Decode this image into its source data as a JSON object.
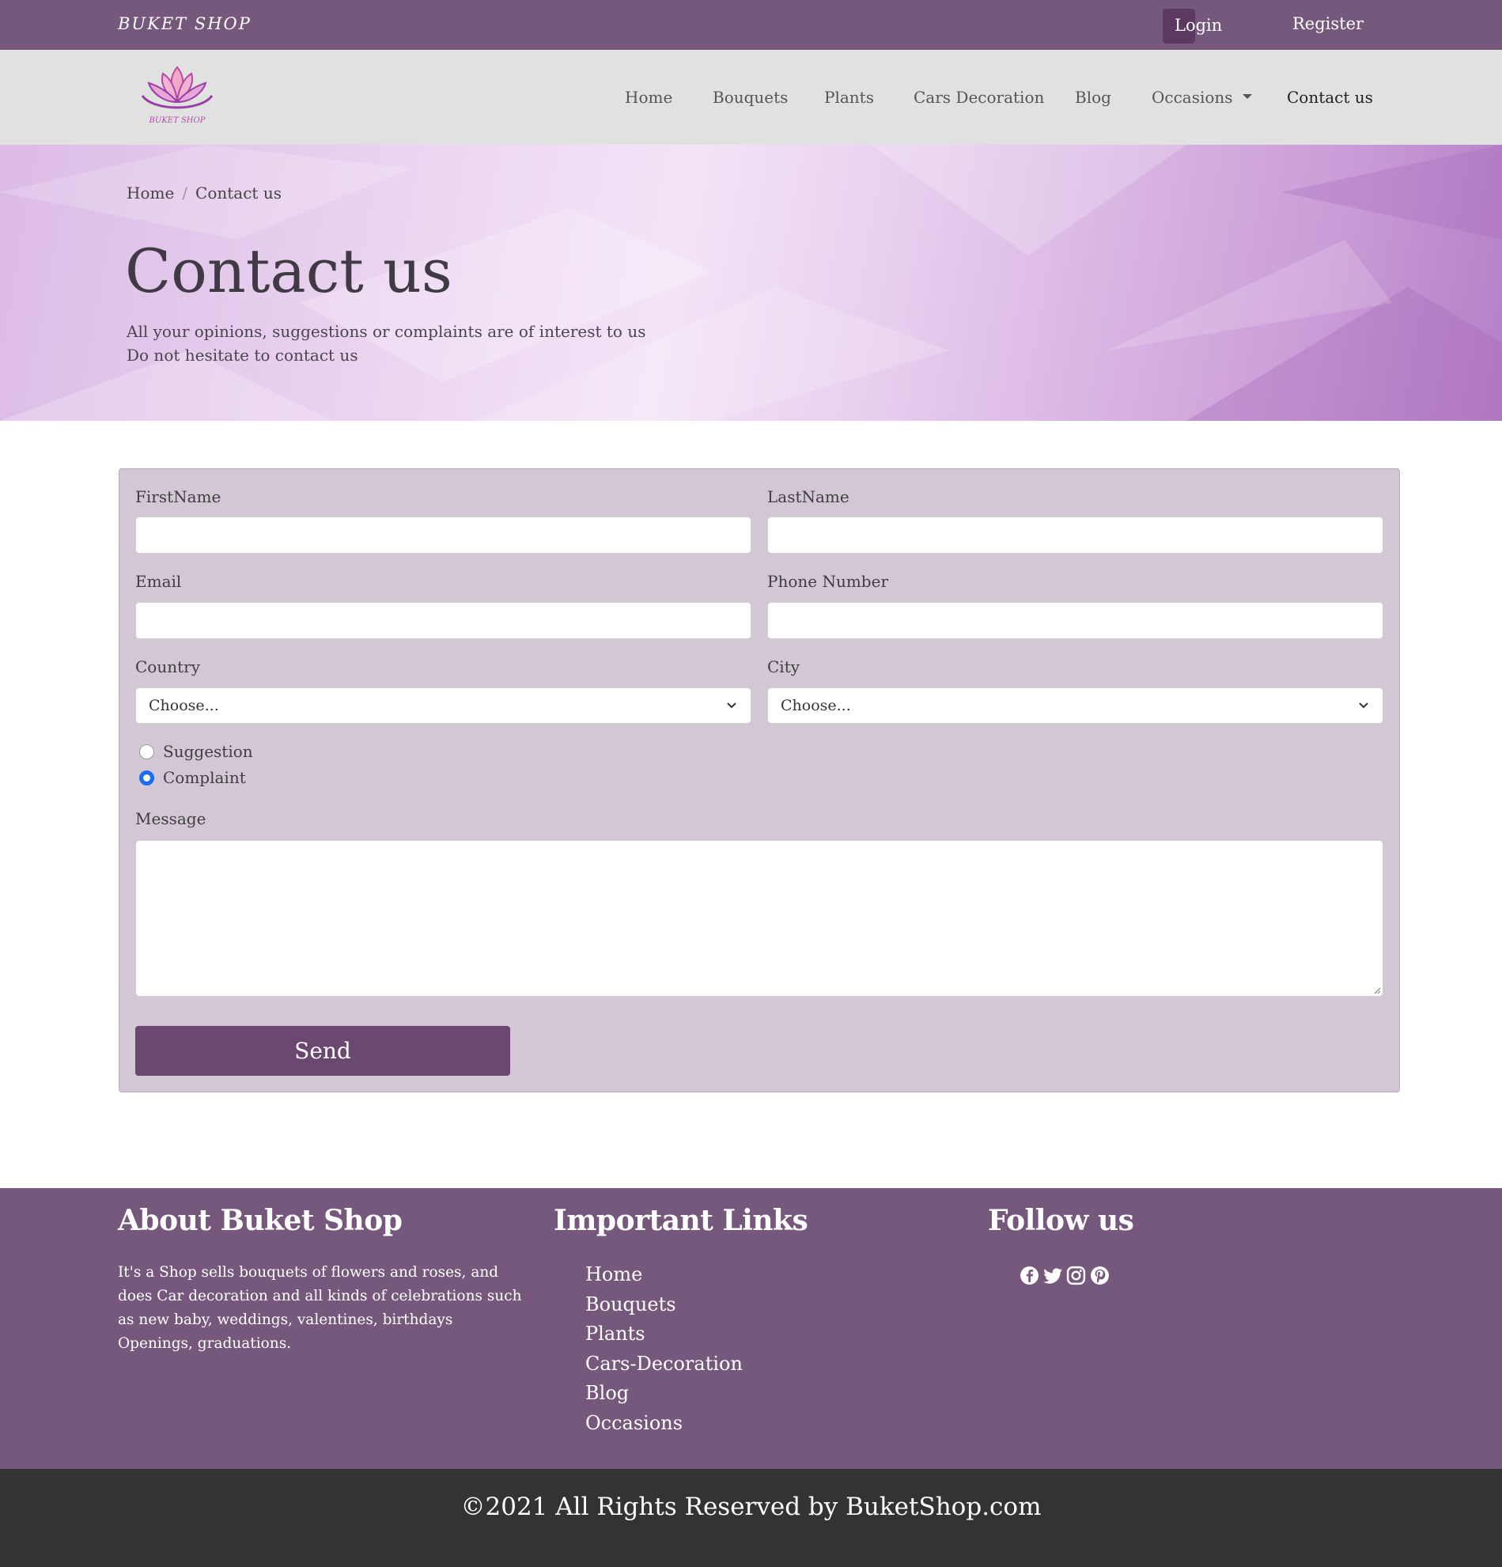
{
  "topbar": {
    "brand": "BUKET SHOP",
    "login": "Login",
    "register": "Register"
  },
  "nav": {
    "items": [
      "Home",
      "Bouquets",
      "Plants",
      "Cars Decoration",
      "Blog",
      "Occasions",
      "Contact us"
    ],
    "active": "Contact us"
  },
  "logo": {
    "caption": "BUKET SHOP"
  },
  "hero": {
    "breadcrumb": [
      "Home",
      "Contact us"
    ],
    "title": "Contact us",
    "subtitle_line1": "All your opinions, suggestions or complaints are of interest to us",
    "subtitle_line2": "Do not hesitate to contact us"
  },
  "form": {
    "firstname_label": "FirstName",
    "firstname_value": "",
    "lastname_label": "LastName",
    "lastname_value": "",
    "email_label": "Email",
    "email_value": "",
    "phone_label": "Phone Number",
    "phone_value": "",
    "country_label": "Country",
    "country_selected": "Choose...",
    "city_label": "City",
    "city_selected": "Choose...",
    "radio_options": [
      "Suggestion",
      "Complaint"
    ],
    "radio_selected": "Complaint",
    "message_label": "Message",
    "message_value": "",
    "send": "Send"
  },
  "footer": {
    "about_heading": "About Buket Shop",
    "about_text": "It's a Shop sells bouquets of flowers and roses, and does Car decoration and all kinds of celebrations such as new baby, weddings, valentines, birthdays Openings, graduations.",
    "links_heading": "Important Links",
    "links": [
      "Home",
      "Bouquets",
      "Plants",
      "Cars-Decoration",
      "Blog",
      "Occasions"
    ],
    "follow_heading": "Follow us",
    "social_icons": [
      "facebook-icon",
      "twitter-icon",
      "instagram-icon",
      "pinterest-icon"
    ],
    "copyright": "©2021 All Rights Reserved by BuketShop.com"
  },
  "colors": {
    "topbar": "#77587d",
    "navbar": "#e1e1e1",
    "card": "#d3c6d5",
    "button": "#6b4870",
    "radio_accent": "#1a6cf3",
    "bottom_bar": "#333333"
  }
}
